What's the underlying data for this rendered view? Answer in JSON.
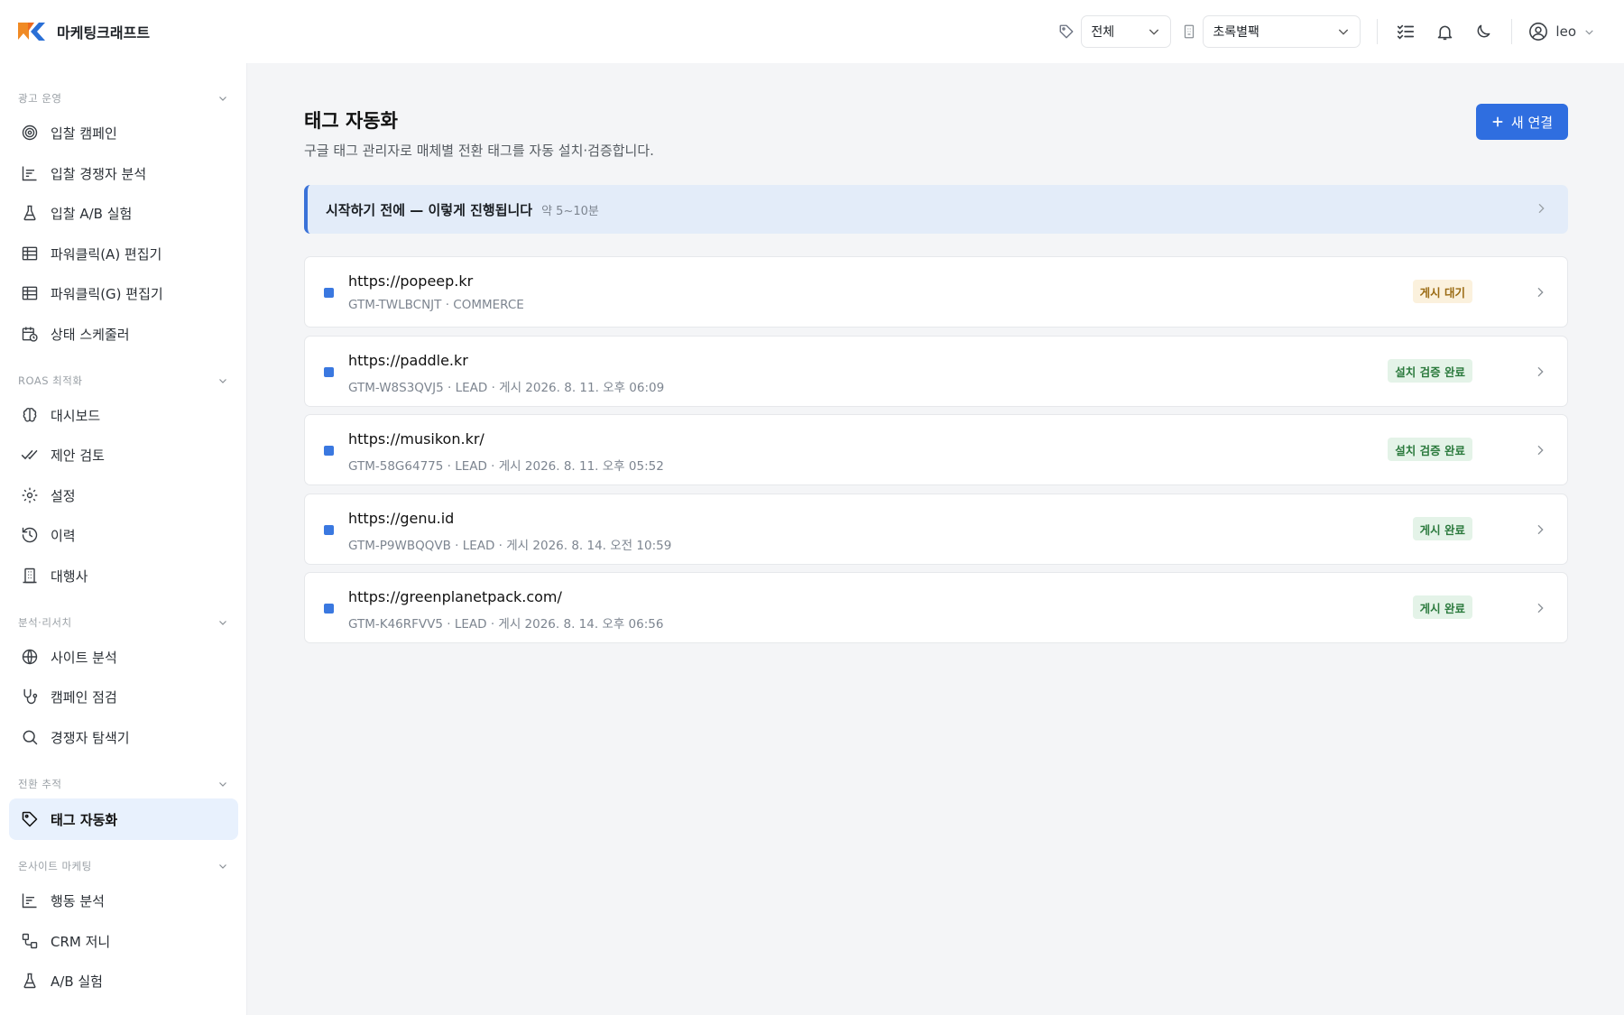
{
  "app": {
    "brand": "마케팅크래프트"
  },
  "header": {
    "tag_filter": "전체",
    "account_select": "초록별팩",
    "user_name": "leo"
  },
  "sidebar": {
    "sections": [
      {
        "label": "광고 운영",
        "items": [
          "입찰 캠페인",
          "입찰 경쟁자 분석",
          "입찰 A/B 실험",
          "파워클릭(A) 편집기",
          "파워클릭(G) 편집기",
          "상태 스케줄러"
        ]
      },
      {
        "label": "ROAS 최적화",
        "items": [
          "대시보드",
          "제안 검토",
          "설정",
          "이력",
          "대행사"
        ]
      },
      {
        "label": "분석·리서치",
        "items": [
          "사이트 분석",
          "캠페인 점검",
          "경쟁자 탐색기"
        ]
      },
      {
        "label": "전환 추적",
        "items": [
          "태그 자동화"
        ]
      },
      {
        "label": "온사이트 마케팅",
        "items": [
          "행동 분석",
          "CRM 저니",
          "A/B 실험"
        ]
      }
    ]
  },
  "page": {
    "title": "태그 자동화",
    "subtitle": "구글 태그 관리자로 매체별 전환 태그를 자동 설치·검증합니다.",
    "new_button": "새 연결",
    "banner_title": "시작하기 전에 — 이렇게 진행됩니다",
    "banner_time": "약 5~10분"
  },
  "connections": [
    {
      "url": "https://popeep.kr",
      "meta": "GTM-TWLBCNJT · COMMERCE",
      "status": "게시 대기"
    },
    {
      "url": "https://paddle.kr",
      "meta": "GTM-W8S3QVJ5 · LEAD · 게시 2026. 8. 11. 오후 06:09",
      "status": "설치 검증 완료"
    },
    {
      "url": "https://musikon.kr/",
      "meta": "GTM-58G64775 · LEAD · 게시 2026. 8. 11. 오후 05:52",
      "status": "설치 검증 완료"
    },
    {
      "url": "https://genu.id",
      "meta": "GTM-P9WBQQVB · LEAD · 게시 2026. 8. 14. 오전 10:59",
      "status": "게시 완료"
    },
    {
      "url": "https://greenplanetpack.com/",
      "meta": "GTM-K46RFVV5 · LEAD · 게시 2026. 8. 14. 오후 06:56",
      "status": "게시 완료"
    }
  ],
  "colors": {
    "accent": "#2f6ee0",
    "active_bg": "#e8f1fd",
    "banner_bg": "#e3ecf9",
    "pending": "#9a6a12",
    "success": "#2b7a3d"
  },
  "icons": [
    "tag-icon",
    "building-icon",
    "checklist-icon",
    "bell-icon",
    "moon-icon",
    "user-circle-icon",
    "chevron-down-icon",
    "chevron-right-icon",
    "plus-icon"
  ]
}
